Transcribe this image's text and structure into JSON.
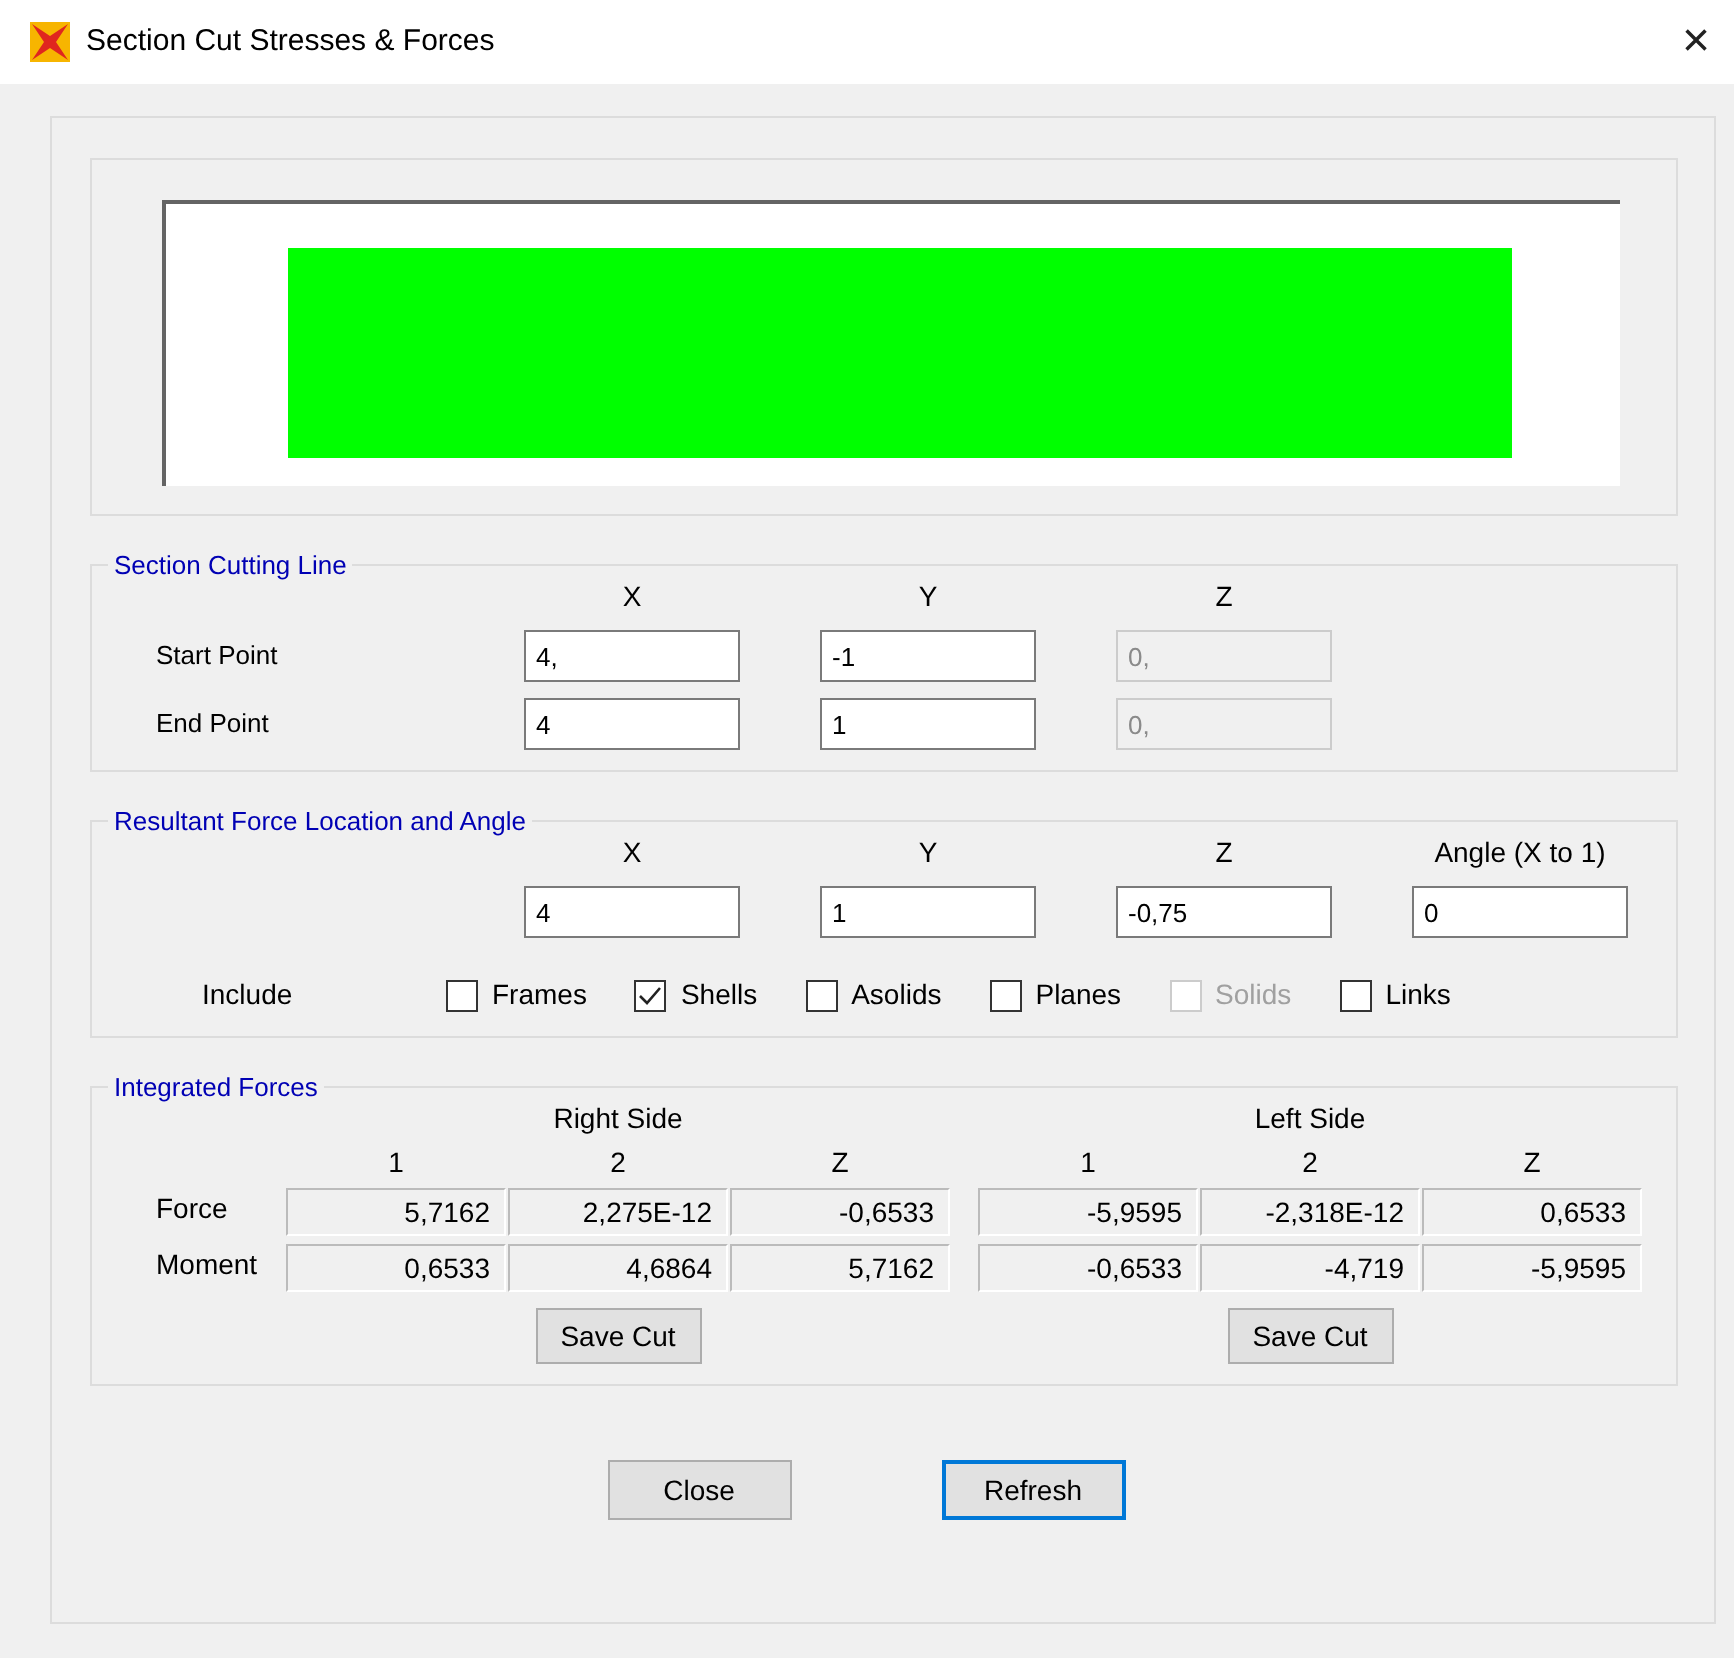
{
  "window": {
    "title": "Section Cut Stresses & Forces",
    "close": "×"
  },
  "section_cutting_line": {
    "title": "Section Cutting Line",
    "columns": [
      "X",
      "Y",
      "Z"
    ],
    "rows": [
      {
        "label": "Start Point",
        "fields": [
          {
            "value": "4,",
            "disabled": false
          },
          {
            "value": "-1",
            "disabled": false
          },
          {
            "value": "0,",
            "disabled": true
          }
        ]
      },
      {
        "label": "End Point",
        "fields": [
          {
            "value": "4",
            "disabled": false
          },
          {
            "value": "1",
            "disabled": false
          },
          {
            "value": "0,",
            "disabled": true
          }
        ]
      }
    ]
  },
  "resultant_force": {
    "title": "Resultant Force Location and Angle",
    "columns": [
      "X",
      "Y",
      "Z",
      "Angle (X to 1)"
    ],
    "fields": [
      {
        "value": "4",
        "disabled": false
      },
      {
        "value": "1",
        "disabled": false
      },
      {
        "value": "-0,75",
        "disabled": false
      },
      {
        "value": "0",
        "disabled": false
      }
    ],
    "include_label": "Include",
    "include": [
      {
        "label": "Frames",
        "checked": false,
        "disabled": false
      },
      {
        "label": "Shells",
        "checked": true,
        "disabled": false
      },
      {
        "label": "Asolids",
        "checked": false,
        "disabled": false
      },
      {
        "label": "Planes",
        "checked": false,
        "disabled": false
      },
      {
        "label": "Solids",
        "checked": false,
        "disabled": true
      },
      {
        "label": "Links",
        "checked": false,
        "disabled": false
      }
    ]
  },
  "integrated_forces": {
    "title": "Integrated Forces",
    "row_labels": [
      "Force",
      "Moment"
    ],
    "sides": [
      {
        "title": "Right Side",
        "columns": [
          "1",
          "2",
          "Z"
        ],
        "rows": [
          [
            "5,7162",
            "2,275E-12",
            "-0,6533"
          ],
          [
            "0,6533",
            "4,6864",
            "5,7162"
          ]
        ],
        "button": "Save Cut"
      },
      {
        "title": "Left Side",
        "columns": [
          "1",
          "2",
          "Z"
        ],
        "rows": [
          [
            "-5,9595",
            "-2,318E-12",
            "0,6533"
          ],
          [
            "-0,6533",
            "-4,719",
            "-5,9595"
          ]
        ],
        "button": "Save Cut"
      }
    ]
  },
  "buttons": [
    {
      "label": "Close",
      "default": false
    },
    {
      "label": "Refresh",
      "default": true
    }
  ]
}
